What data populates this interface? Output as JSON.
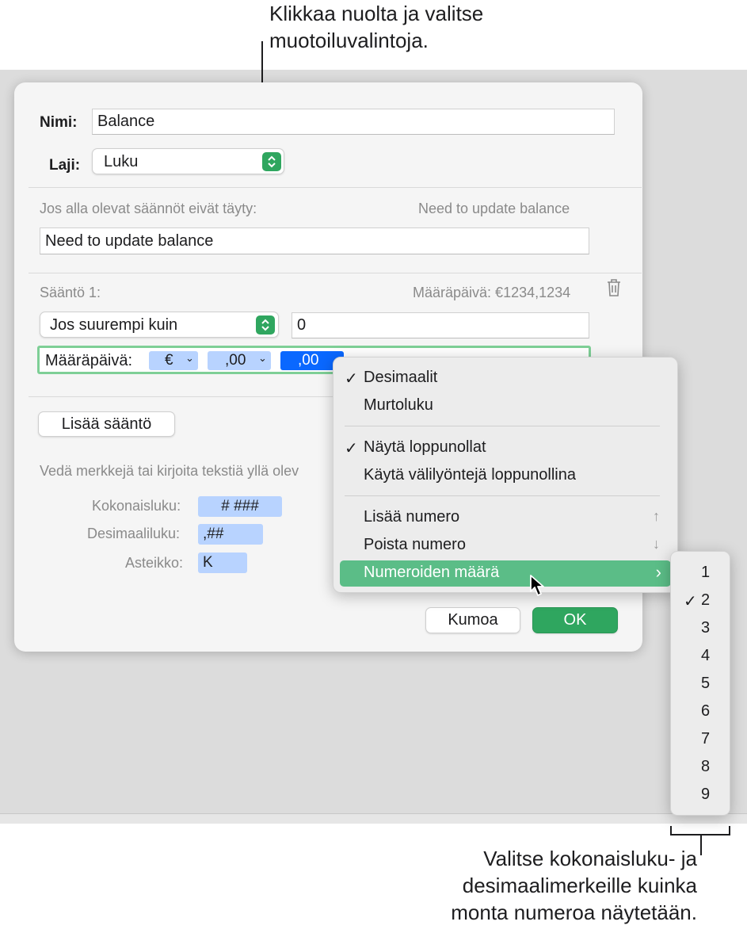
{
  "callouts": {
    "top": [
      "Klikkaa nuolta ja valitse",
      "muotoiluvalintoja."
    ],
    "bottom": [
      "Valitse kokonaisluku- ja",
      "desimaalimerkeille kuinka",
      "monta numeroa näytetään."
    ]
  },
  "dialog": {
    "name_label": "Nimi:",
    "name_value": "Balance",
    "type_label": "Laji:",
    "type_value": "Luku",
    "fallback_caption": "Jos alla olevat säännöt eivät täyty:",
    "fallback_preview": "Need to update balance",
    "fallback_value": "Need to update balance",
    "rule": {
      "title": "Sääntö 1:",
      "preview": "Määräpäivä: €1234,1234",
      "condition": "Jos suurempi kuin",
      "condition_value": "0",
      "format_label": "Määräpäivä:",
      "tokens": [
        "€",
        ",00",
        ",00"
      ]
    },
    "add_rule_button": "Lisää sääntö",
    "hint": "Vedä merkkejä tai kirjoita tekstiä yllä olev",
    "elements": [
      {
        "label": "Kokonaisluku:",
        "token": "# ###"
      },
      {
        "label": "Desimaaliluku:",
        "token": ",##"
      },
      {
        "label": "Asteikko:",
        "token": "K"
      }
    ],
    "cancel_button": "Kumoa",
    "ok_button": "OK"
  },
  "menu": {
    "items": [
      {
        "label": "Desimaalit",
        "checked": "✓"
      },
      {
        "label": "Murtoluku",
        "checked": ""
      },
      {
        "label": "Näytä loppunollat",
        "checked": "✓"
      },
      {
        "label": "Käytä välilyöntejä loppunollina",
        "checked": ""
      },
      {
        "label": "Lisää numero",
        "key": "↑"
      },
      {
        "label": "Poista numero",
        "key": "↓"
      },
      {
        "label": "Numeroiden määrä",
        "key": "›"
      }
    ]
  },
  "submenu": {
    "items": [
      "1",
      "2",
      "3",
      "4",
      "5",
      "6",
      "7",
      "8",
      "9"
    ],
    "selected": "2"
  },
  "colors": {
    "accent_green": "#2fa65f",
    "menu_highlight": "#5bbd87",
    "token_blue": "#b8d3ff",
    "token_selected": "#0a68ff"
  }
}
